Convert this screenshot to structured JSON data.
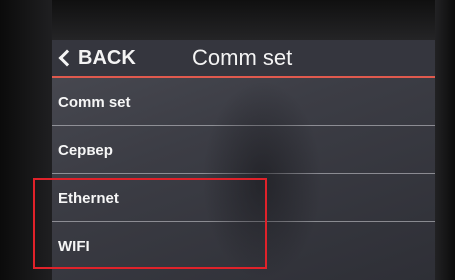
{
  "header": {
    "back_label": "BACK",
    "title": "Comm set"
  },
  "menu": {
    "items": [
      {
        "label": "Comm set"
      },
      {
        "label": "Сервер"
      },
      {
        "label": "Ethernet"
      },
      {
        "label": "WIFI"
      }
    ]
  },
  "colors": {
    "accent_line": "#e05a4e",
    "highlight_box": "#e0222a",
    "screen_background": "#3c3d45",
    "text": "#f4f4f4"
  }
}
